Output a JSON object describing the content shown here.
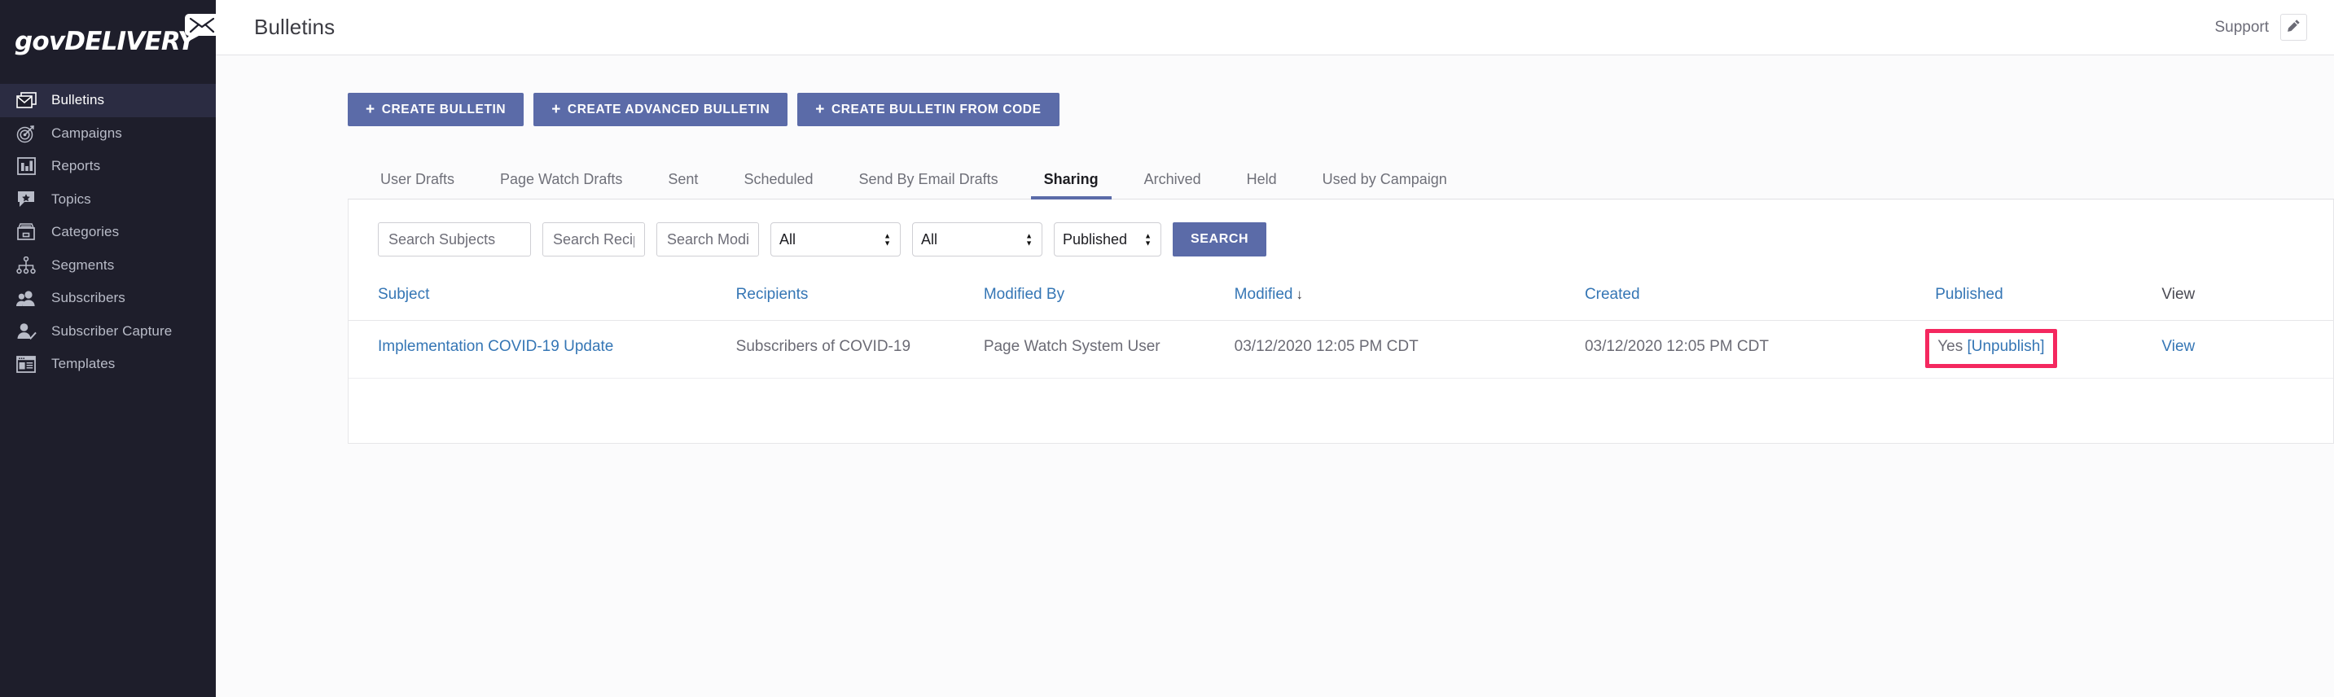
{
  "brand": {
    "name_upper": "GOV",
    "name_lower": "DELIVERY",
    "full": "govDELIVERY",
    "envelope_icon": "envelope-speech-icon"
  },
  "sidebar": {
    "items": [
      {
        "label": "Bulletins",
        "icon": "envelope-icon",
        "active": true
      },
      {
        "label": "Campaigns",
        "icon": "target-icon",
        "active": false
      },
      {
        "label": "Reports",
        "icon": "bar-chart-icon",
        "active": false
      },
      {
        "label": "Topics",
        "icon": "comment-star-icon",
        "active": false
      },
      {
        "label": "Categories",
        "icon": "file-box-icon",
        "active": false
      },
      {
        "label": "Segments",
        "icon": "sitemap-icon",
        "active": false
      },
      {
        "label": "Subscribers",
        "icon": "users-icon",
        "active": false
      },
      {
        "label": "Subscriber Capture",
        "icon": "user-check-icon",
        "active": false
      },
      {
        "label": "Templates",
        "icon": "layout-window-icon",
        "active": false
      }
    ]
  },
  "header": {
    "title": "Bulletins",
    "support_label": "Support",
    "edit_icon": "pencil-icon"
  },
  "actions": {
    "plus_glyph": "+",
    "buttons": [
      {
        "label": "CREATE BULLETIN"
      },
      {
        "label": "CREATE ADVANCED BULLETIN"
      },
      {
        "label": "CREATE BULLETIN FROM CODE"
      }
    ]
  },
  "tabs": [
    {
      "label": "User Drafts",
      "active": false
    },
    {
      "label": "Page Watch Drafts",
      "active": false
    },
    {
      "label": "Sent",
      "active": false
    },
    {
      "label": "Scheduled",
      "active": false
    },
    {
      "label": "Send By Email Drafts",
      "active": false
    },
    {
      "label": "Sharing",
      "active": true
    },
    {
      "label": "Archived",
      "active": false
    },
    {
      "label": "Held",
      "active": false
    },
    {
      "label": "Used by Campaign",
      "active": false
    }
  ],
  "filters": {
    "search_subjects": {
      "value": "",
      "placeholder": "Search Subjects"
    },
    "search_recipients": {
      "value": "",
      "placeholder": "Search Recip"
    },
    "search_modified_by": {
      "value": "",
      "placeholder": "Search Modif"
    },
    "select_one": {
      "value": "All",
      "options": [
        "All"
      ]
    },
    "select_two": {
      "value": "All",
      "options": [
        "All"
      ]
    },
    "select_three": {
      "value": "Published",
      "options": [
        "Published"
      ]
    },
    "search_button": "SEARCH"
  },
  "table": {
    "columns": [
      {
        "label": "Subject",
        "link": true,
        "sort": ""
      },
      {
        "label": "Recipients",
        "link": true,
        "sort": ""
      },
      {
        "label": "Modified By",
        "link": true,
        "sort": ""
      },
      {
        "label": "Modified",
        "link": true,
        "sort": "↓"
      },
      {
        "label": "Created",
        "link": true,
        "sort": ""
      },
      {
        "label": "Published",
        "link": true,
        "sort": ""
      },
      {
        "label": "View",
        "link": false,
        "sort": ""
      }
    ],
    "rows": [
      {
        "subject": "Implementation COVID-19 Update",
        "recipients": "Subscribers of COVID-19",
        "modified_by": "Page Watch System User",
        "modified": "03/12/2020 12:05 PM CDT",
        "created": "03/12/2020 12:05 PM CDT",
        "published_value": "Yes",
        "published_action": "[Unpublish]",
        "view": "View",
        "highlighted": true
      }
    ]
  },
  "colors": {
    "sidebar_bg": "#1e1e2b",
    "sidebar_active_bg": "#2b2c42",
    "primary_button": "#5b6ba8",
    "link": "#3576b5",
    "highlight_outline": "#f4285f",
    "page_bg": "#fbfbfc"
  }
}
